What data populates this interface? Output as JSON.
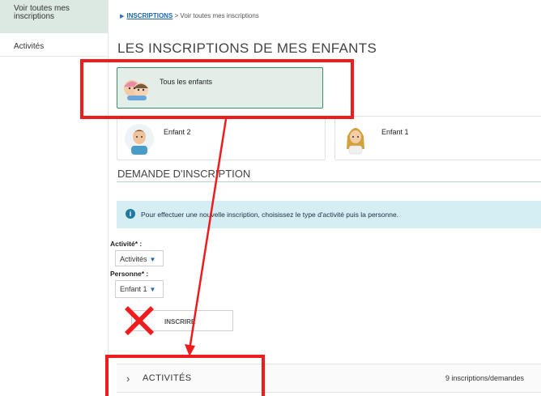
{
  "sidebar": {
    "items": [
      {
        "label": "Voir toutes mes inscriptions",
        "active": true
      },
      {
        "label": "Activités",
        "active": false
      }
    ]
  },
  "breadcrumb": {
    "link": "INSCRIPTIONS",
    "current": "> Voir toutes mes inscriptions"
  },
  "page": {
    "title": "LES INSCRIPTIONS DE MES ENFANTS"
  },
  "children": {
    "all_label": "Tous les enfants",
    "cards": [
      {
        "label": "Enfant 2",
        "icon": "boy-avatar-icon"
      },
      {
        "label": "Enfant 1",
        "icon": "girl-avatar-icon"
      }
    ]
  },
  "request": {
    "section_title": "DEMANDE D'INSCRIPTION",
    "info_text": "Pour effectuer une nouvelle inscription, choisissez le type d'activité puis la personne.",
    "activity_label": "Activité* :",
    "activity_value": "Activités",
    "person_label": "Personne* :",
    "person_value": "Enfant 1",
    "submit_label": "INSCRIRE"
  },
  "accordion": {
    "title": "ACTIVITÉS",
    "count": "9 inscriptions/demandes"
  },
  "colors": {
    "annotation": "#ee1c1c",
    "selected_card_bg": "#e3eee9",
    "info_bg": "#d4eef4",
    "link": "#1f66b0"
  }
}
